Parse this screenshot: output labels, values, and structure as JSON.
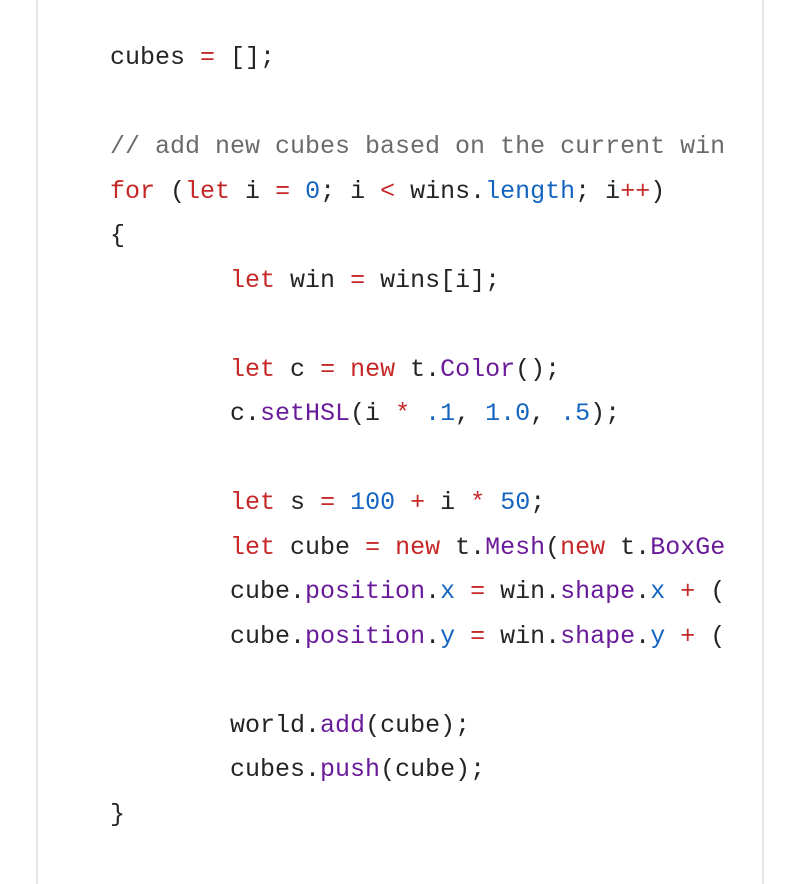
{
  "code": {
    "lines": [
      [
        {
          "t": "cubes ",
          "c": "pln"
        },
        {
          "t": "=",
          "c": "op"
        },
        {
          "t": " [];",
          "c": "pln"
        }
      ],
      [],
      [
        {
          "t": "// add new cubes based on the current win",
          "c": "cmt"
        }
      ],
      [
        {
          "t": "for",
          "c": "kw"
        },
        {
          "t": " (",
          "c": "pln"
        },
        {
          "t": "let",
          "c": "kw"
        },
        {
          "t": " i ",
          "c": "pln"
        },
        {
          "t": "=",
          "c": "op"
        },
        {
          "t": " ",
          "c": "pln"
        },
        {
          "t": "0",
          "c": "num"
        },
        {
          "t": "; i ",
          "c": "pln"
        },
        {
          "t": "<",
          "c": "op"
        },
        {
          "t": " wins.",
          "c": "pln"
        },
        {
          "t": "length",
          "c": "prop"
        },
        {
          "t": "; i",
          "c": "pln"
        },
        {
          "t": "++",
          "c": "op"
        },
        {
          "t": ")",
          "c": "pln"
        }
      ],
      [
        {
          "t": "{",
          "c": "pln"
        }
      ],
      [
        {
          "t": "        ",
          "c": "pln"
        },
        {
          "t": "let",
          "c": "kw"
        },
        {
          "t": " win ",
          "c": "pln"
        },
        {
          "t": "=",
          "c": "op"
        },
        {
          "t": " wins[i];",
          "c": "pln"
        }
      ],
      [],
      [
        {
          "t": "        ",
          "c": "pln"
        },
        {
          "t": "let",
          "c": "kw"
        },
        {
          "t": " c ",
          "c": "pln"
        },
        {
          "t": "=",
          "c": "op"
        },
        {
          "t": " ",
          "c": "pln"
        },
        {
          "t": "new",
          "c": "kw"
        },
        {
          "t": " t.",
          "c": "pln"
        },
        {
          "t": "Color",
          "c": "type"
        },
        {
          "t": "();",
          "c": "pln"
        }
      ],
      [
        {
          "t": "        c.",
          "c": "pln"
        },
        {
          "t": "setHSL",
          "c": "fn"
        },
        {
          "t": "(i ",
          "c": "pln"
        },
        {
          "t": "*",
          "c": "op"
        },
        {
          "t": " ",
          "c": "pln"
        },
        {
          "t": ".1",
          "c": "num"
        },
        {
          "t": ", ",
          "c": "pln"
        },
        {
          "t": "1.0",
          "c": "num"
        },
        {
          "t": ", ",
          "c": "pln"
        },
        {
          "t": ".5",
          "c": "num"
        },
        {
          "t": ");",
          "c": "pln"
        }
      ],
      [],
      [
        {
          "t": "        ",
          "c": "pln"
        },
        {
          "t": "let",
          "c": "kw"
        },
        {
          "t": " s ",
          "c": "pln"
        },
        {
          "t": "=",
          "c": "op"
        },
        {
          "t": " ",
          "c": "pln"
        },
        {
          "t": "100",
          "c": "num"
        },
        {
          "t": " ",
          "c": "pln"
        },
        {
          "t": "+",
          "c": "op"
        },
        {
          "t": " i ",
          "c": "pln"
        },
        {
          "t": "*",
          "c": "op"
        },
        {
          "t": " ",
          "c": "pln"
        },
        {
          "t": "50",
          "c": "num"
        },
        {
          "t": ";",
          "c": "pln"
        }
      ],
      [
        {
          "t": "        ",
          "c": "pln"
        },
        {
          "t": "let",
          "c": "kw"
        },
        {
          "t": " cube ",
          "c": "pln"
        },
        {
          "t": "=",
          "c": "op"
        },
        {
          "t": " ",
          "c": "pln"
        },
        {
          "t": "new",
          "c": "kw"
        },
        {
          "t": " t.",
          "c": "pln"
        },
        {
          "t": "Mesh",
          "c": "type"
        },
        {
          "t": "(",
          "c": "pln"
        },
        {
          "t": "new",
          "c": "kw"
        },
        {
          "t": " t.",
          "c": "pln"
        },
        {
          "t": "BoxGe",
          "c": "type"
        }
      ],
      [
        {
          "t": "        cube.",
          "c": "pln"
        },
        {
          "t": "position",
          "c": "fn"
        },
        {
          "t": ".",
          "c": "pln"
        },
        {
          "t": "x",
          "c": "prop"
        },
        {
          "t": " ",
          "c": "pln"
        },
        {
          "t": "=",
          "c": "op"
        },
        {
          "t": " win.",
          "c": "pln"
        },
        {
          "t": "shape",
          "c": "fn"
        },
        {
          "t": ".",
          "c": "pln"
        },
        {
          "t": "x",
          "c": "prop"
        },
        {
          "t": " ",
          "c": "pln"
        },
        {
          "t": "+",
          "c": "op"
        },
        {
          "t": " (",
          "c": "pln"
        }
      ],
      [
        {
          "t": "        cube.",
          "c": "pln"
        },
        {
          "t": "position",
          "c": "fn"
        },
        {
          "t": ".",
          "c": "pln"
        },
        {
          "t": "y",
          "c": "prop"
        },
        {
          "t": " ",
          "c": "pln"
        },
        {
          "t": "=",
          "c": "op"
        },
        {
          "t": " win.",
          "c": "pln"
        },
        {
          "t": "shape",
          "c": "fn"
        },
        {
          "t": ".",
          "c": "pln"
        },
        {
          "t": "y",
          "c": "prop"
        },
        {
          "t": " ",
          "c": "pln"
        },
        {
          "t": "+",
          "c": "op"
        },
        {
          "t": " (",
          "c": "pln"
        }
      ],
      [],
      [
        {
          "t": "        world.",
          "c": "pln"
        },
        {
          "t": "add",
          "c": "fn"
        },
        {
          "t": "(cube);",
          "c": "pln"
        }
      ],
      [
        {
          "t": "        cubes.",
          "c": "pln"
        },
        {
          "t": "push",
          "c": "fn"
        },
        {
          "t": "(cube);",
          "c": "pln"
        }
      ],
      [
        {
          "t": "}",
          "c": "pln"
        }
      ]
    ]
  }
}
